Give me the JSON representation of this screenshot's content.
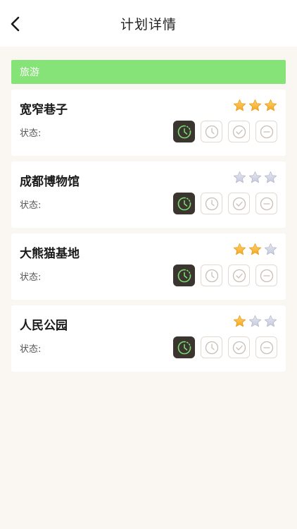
{
  "header": {
    "title": "计划详情",
    "back_icon": "chevron-left-icon"
  },
  "category": {
    "label": "旅游",
    "color": "#86e377"
  },
  "status_label": "状态:",
  "status_icons": [
    "in-progress-icon",
    "pending-clock-icon",
    "done-check-icon",
    "cancel-minus-icon"
  ],
  "colors": {
    "star_filled": "#f6a623",
    "star_empty": "#c4c8dc",
    "active_bg": "#3a362f",
    "active_icon": "#7cd870",
    "inactive_icon": "#c9beb5"
  },
  "items": [
    {
      "name": "宽窄巷子",
      "rating": 3,
      "max_rating": 3,
      "active_status": 0
    },
    {
      "name": "成都博物馆",
      "rating": 0,
      "max_rating": 3,
      "active_status": 0
    },
    {
      "name": "大熊猫基地",
      "rating": 2,
      "max_rating": 3,
      "active_status": 0
    },
    {
      "name": "人民公园",
      "rating": 1,
      "max_rating": 3,
      "active_status": 0
    }
  ]
}
